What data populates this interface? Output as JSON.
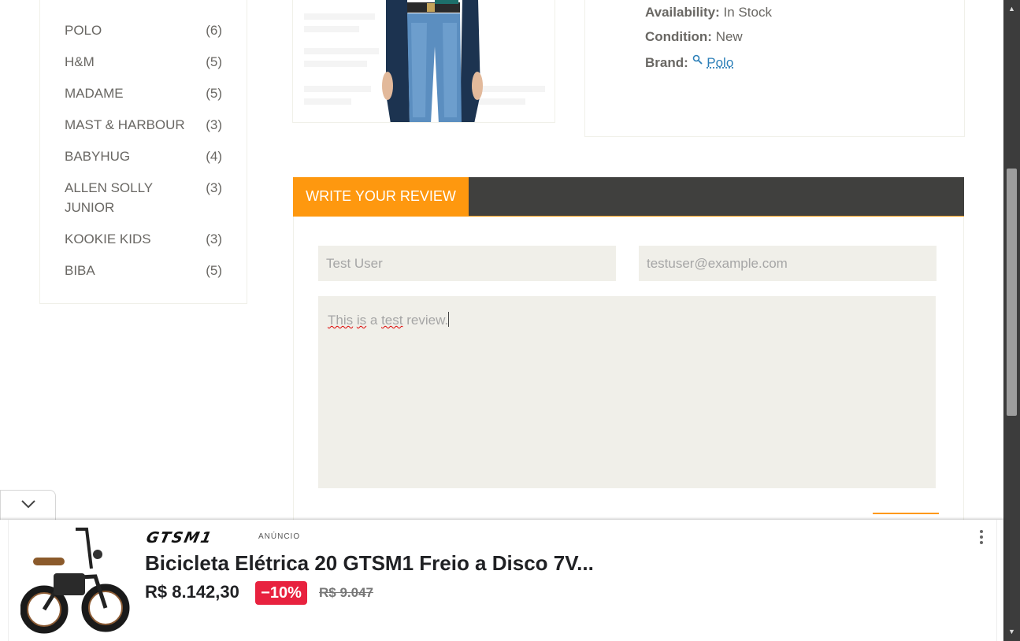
{
  "brands": [
    {
      "name": "POLO",
      "count": "(6)"
    },
    {
      "name": "H&M",
      "count": "(5)"
    },
    {
      "name": "MADAME",
      "count": "(5)"
    },
    {
      "name": "MAST & HARBOUR",
      "count": "(3)"
    },
    {
      "name": "BABYHUG",
      "count": "(4)"
    },
    {
      "name": "ALLEN SOLLY JUNIOR",
      "count": "(3)"
    },
    {
      "name": "KOOKIE KIDS",
      "count": "(3)"
    },
    {
      "name": "BIBA",
      "count": "(5)"
    }
  ],
  "product": {
    "availability_label": "Availability:",
    "availability_value": "In Stock",
    "condition_label": "Condition:",
    "condition_value": "New",
    "brand_label": "Brand:",
    "brand_value": "Polo"
  },
  "review": {
    "tab_label": "WRITE YOUR REVIEW",
    "name_value": "Test User",
    "email_value": "testuser@example.com",
    "text_words": [
      "This",
      "is",
      "a",
      "test",
      "review."
    ]
  },
  "ad": {
    "logo": "GTSM1",
    "label": "ANÚNCIO",
    "title": "Bicicleta Elétrica 20 GTSM1 Freio a Disco 7V...",
    "price": "R$ 8.142,30",
    "discount": "−10%",
    "old_price": "R$ 9.047"
  },
  "colors": {
    "accent": "#fe980f",
    "tabbar": "#40403e",
    "field_bg": "#f0efe9",
    "discount": "#e8223f",
    "link": "#2c7fb8"
  },
  "icons": {
    "brand_link": "search-icon",
    "ad_toggle": "chevron-down-icon",
    "ad_menu": "more-vert-icon",
    "scroll_up": "arrow-up-icon",
    "scroll_down": "arrow-down-icon"
  }
}
